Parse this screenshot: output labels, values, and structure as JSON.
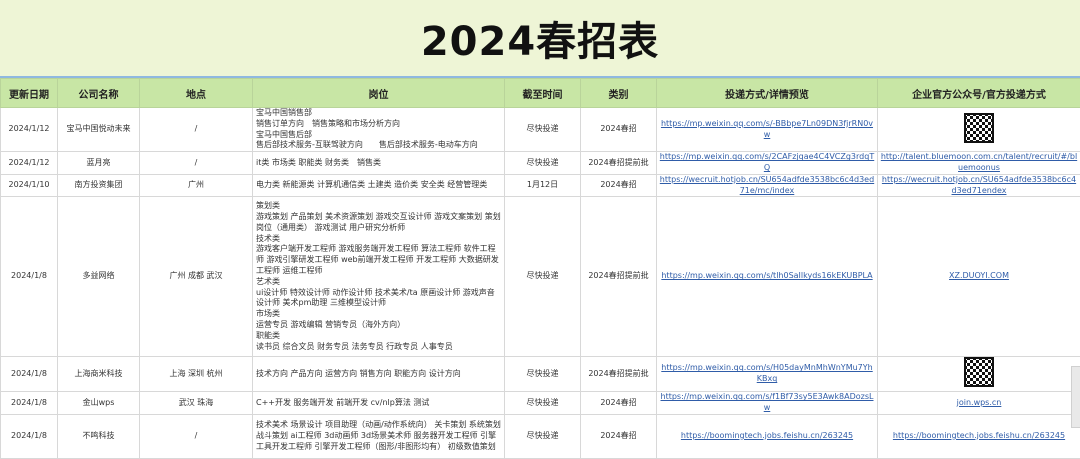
{
  "title": "2024春招表",
  "headers": [
    "更新日期",
    "公司名称",
    "地点",
    "岗位",
    "截至时间",
    "类别",
    "投递方式/详情预览",
    "企业官方公众号/官方投递方式"
  ],
  "rows": [
    {
      "date": "2024/1/12",
      "company": "宝马中国悦动未来",
      "location": "/",
      "positions": "宝马中国销售部\n销售订单方向　销售策略和市场分析方向\n宝马中国售后部\n售后部技术服务-互联驾驶方向　　售后部技术服务-电动车方向",
      "deadline": "尽快投递",
      "category": "2024春招",
      "apply": "https://mp.weixin.qq.com/s/-BBbpe7Ln09DN3fjrRN0vw",
      "official": "",
      "official_qr": true
    },
    {
      "date": "2024/1/12",
      "company": "蓝月亮",
      "location": "/",
      "positions": "it类 市场类 职能类 财务类　销售类",
      "deadline": "尽快投递",
      "category": "2024春招提前批",
      "apply": "https://mp.weixin.qq.com/s/2CAFzjqae4C4VCZg3rdqTQ",
      "official": "http://talent.bluemoon.com.cn/talent/recruit/#/bluemoonus",
      "official_qr": false
    },
    {
      "date": "2024/1/10",
      "company": "南方投资集团",
      "location": "广州",
      "positions": "电力类 新能源类 计算机通信类 土建类 造价类 安全类 经营管理类",
      "deadline": "1月12日",
      "category": "2024春招",
      "apply": "https://wecruit.hotjob.cn/SU654adfde3538bc6c4d3ed71e/mc/index",
      "official": "https://wecruit.hotjob.cn/SU654adfde3538bc6c4d3ed71endex",
      "official_qr": false
    },
    {
      "date": "2024/1/8",
      "company": "多益网络",
      "location": "广州 成都 武汉",
      "positions": "策划类\n游戏策划 产品策划 美术资源策划 游戏交互设计师 游戏文案策划 策划岗位（通用类） 游戏测试 用户研究分析师\n技术类\n游戏客户端开发工程师 游戏服务端开发工程师 算法工程师 软件工程师 游戏引擎研发工程师 web前端开发工程师 开发工程师 大数据研发工程师 运维工程师\n艺术类\nui设计师 特效设计师 动作设计师 技术美术/ta 原画设计师 游戏声音设计师 美术pm助理 三维模型设计师\n市场类\n运营专员 游戏编辑 营销专员（海外方向）\n职能类\n读书员 综合文员 财务专员 法务专员 行政专员 人事专员",
      "deadline": "尽快投递",
      "category": "2024春招提前批",
      "apply": "https://mp.weixin.qq.com/s/tlh0SaIlkyds16kEKUBPLA",
      "official": "XZ.DUOYI.COM",
      "official_qr": false
    },
    {
      "date": "2024/1/8",
      "company": "上海商米科技",
      "location": "上海 深圳 杭州",
      "positions": "技术方向 产品方向 运营方向 销售方向 职能方向 设计方向",
      "deadline": "尽快投递",
      "category": "2024春招提前批",
      "apply": "https://mp.weixin.qq.com/s/H05dayMnMhWnYMu7YhKBxq",
      "official": "",
      "official_qr": true
    },
    {
      "date": "2024/1/8",
      "company": "金山wps",
      "location": "武汉 珠海",
      "positions": "C++开发 服务端开发 前端开发 cv/nlp算法 测试",
      "deadline": "尽快投递",
      "category": "2024春招",
      "apply": "https://mp.weixin.qq.com/s/f1Bf73sy5E3Awk8ADozsLw",
      "official": "join.wps.cn",
      "official_qr": false
    },
    {
      "date": "2024/1/8",
      "company": "不鸣科技",
      "location": "/",
      "positions": "技术美术 场景设计 项目助理（动画/动作系统向） 关卡策划 系统策划 战斗策划 ai工程师 3d动画师 3d场景美术师 服务器开发工程师 引擎工具开发工程师 引擎开发工程师（图形/非图形均有） 初级数值策划",
      "deadline": "尽快投递",
      "category": "2024春招",
      "apply": "https://boomingtech.jobs.feishu.cn/263245",
      "official": "https://boomingtech.jobs.feishu.cn/263245",
      "official_qr": false
    }
  ]
}
